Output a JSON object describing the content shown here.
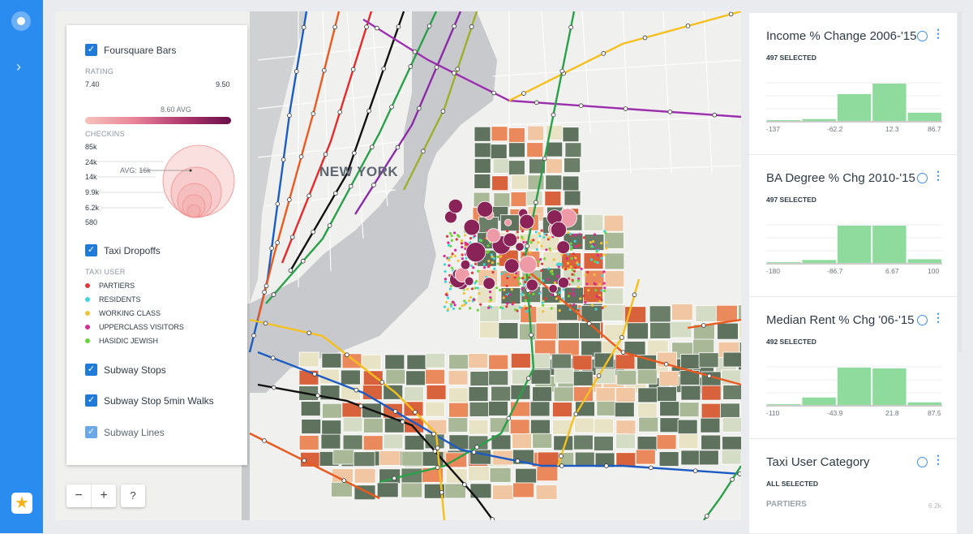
{
  "map": {
    "city_label": "NEW YORK"
  },
  "layers_panel": {
    "foursquare": {
      "title": "Foursquare Bars",
      "rating_label": "RATING",
      "rating_min": "7.40",
      "rating_max": "9.50",
      "rating_avg": "8.60 AVG",
      "checkins_label": "CHECKINS",
      "checkins_ticks": [
        "85k",
        "24k",
        "14k",
        "9.9k",
        "6.2k",
        "580"
      ],
      "checkins_avg": "AVG: 16k"
    },
    "taxi": {
      "title": "Taxi Dropoffs",
      "user_label": "TAXI USER",
      "legend": [
        {
          "label": "PARTIERS",
          "color": "#e03b3b"
        },
        {
          "label": "RESIDENTS",
          "color": "#3fd6d8"
        },
        {
          "label": "WORKING CLASS",
          "color": "#f3c23a"
        },
        {
          "label": "UPPERCLASS VISITORS",
          "color": "#d42c98"
        },
        {
          "label": "HASIDIC JEWISH",
          "color": "#6dd43a"
        }
      ]
    },
    "subway_stops": "Subway Stops",
    "subway_walks": "Subway Stop 5min Walks",
    "subway_lines": "Subway Lines"
  },
  "controls": {
    "zoom_out": "−",
    "zoom_in": "+",
    "help": "?"
  },
  "widgets": [
    {
      "title": "Income % Change 2006-'15",
      "selected": "497 SELECTED",
      "ticks": [
        "-137",
        "-62.2",
        "12.3",
        "86.7"
      ],
      "bins": [
        0.02,
        0.05,
        0.72,
        1.0,
        0.22
      ]
    },
    {
      "title": "BA Degree % Chg 2010-'15",
      "selected": "497 SELECTED",
      "ticks": [
        "-180",
        "-86.7",
        "6.67",
        "100"
      ],
      "bins": [
        0.02,
        0.08,
        1.0,
        1.0,
        0.1
      ]
    },
    {
      "title": "Median Rent % Chg '06-'15",
      "selected": "492 SELECTED",
      "ticks": [
        "-110",
        "-43.9",
        "21.8",
        "87.5"
      ],
      "bins": [
        0.02,
        0.2,
        1.0,
        0.98,
        0.07
      ]
    },
    {
      "title": "Taxi User Category",
      "selected": "ALL SELECTED",
      "first_row": "PARTIERS",
      "first_value": "6.2k"
    }
  ],
  "colors": {
    "accent": "#2b8cf0",
    "bar_fill": "#8fdb9d"
  }
}
